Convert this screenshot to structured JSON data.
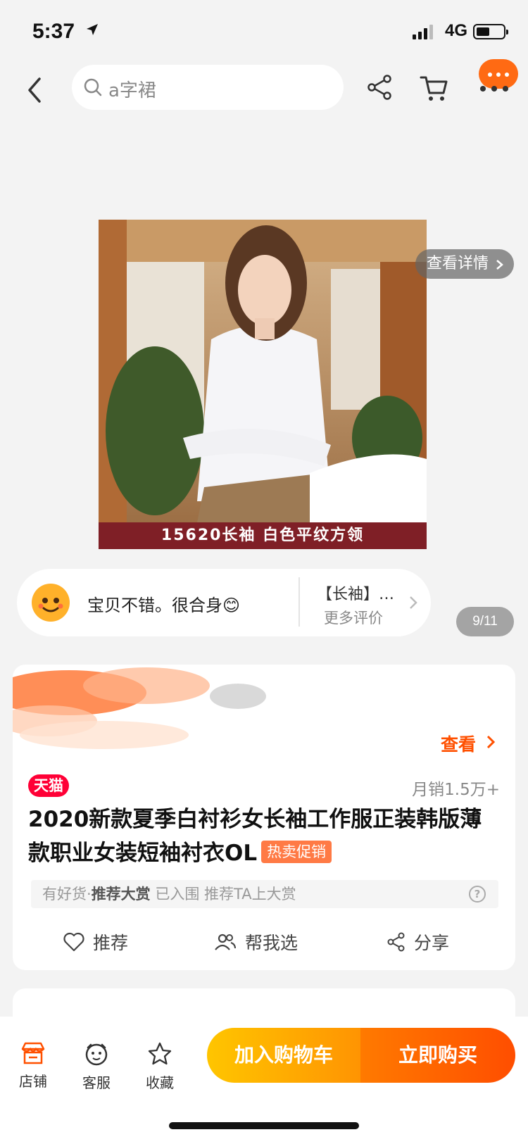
{
  "status_bar": {
    "time": "5:37",
    "network": "4G"
  },
  "nav": {
    "search_placeholder": "a字裙"
  },
  "gallery": {
    "banner_text": "15620长袖  白色平纹方领",
    "detail_label": "查看详情",
    "page_indicator": "9/11"
  },
  "review": {
    "text": "宝贝不错。很合身😊",
    "tag": "【长袖】…",
    "more": "更多评价"
  },
  "product": {
    "view_label": "查看",
    "badge": "天猫",
    "sales": "月销1.5万+",
    "title": "2020新款夏季白衬衫女长袖工作服正装韩版薄款职业女装短袖衬衣OL",
    "hot_tag": "热卖促销",
    "award": {
      "prefix": "有好货·",
      "name": "推荐大赏",
      "suffix": " 已入围 推荐TA上大赏"
    }
  },
  "actions": [
    {
      "label": "推荐",
      "icon": "heart-icon"
    },
    {
      "label": "帮我选",
      "icon": "people-icon"
    },
    {
      "label": "分享",
      "icon": "share-icon"
    }
  ],
  "bottom_bar": {
    "tabs": [
      {
        "label": "店铺",
        "icon": "store-icon"
      },
      {
        "label": "客服",
        "icon": "service-icon"
      },
      {
        "label": "收藏",
        "icon": "star-icon"
      }
    ],
    "add_to_cart": "加入购物车",
    "buy_now": "立即购买"
  },
  "colors": {
    "accent": "#ff5000",
    "tmall": "#ff0036",
    "cart_btn": "#ffb000",
    "buy_btn": "#ff5a00"
  }
}
